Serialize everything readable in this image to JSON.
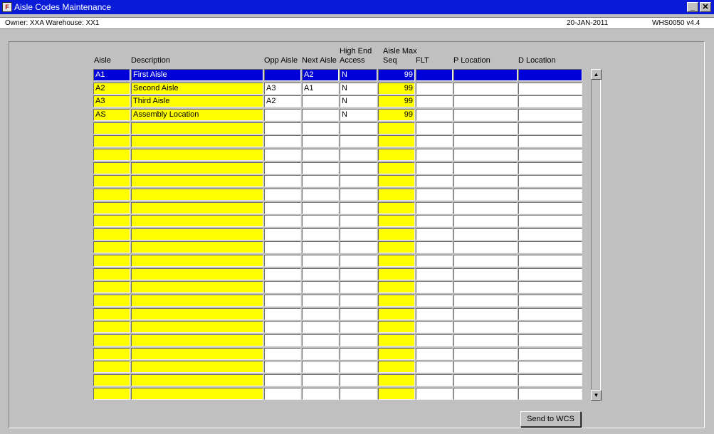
{
  "window": {
    "title": "Aisle Codes Maintenance",
    "minimize_glyph": "_",
    "close_glyph": "✕",
    "app_icon": "oracle-forms-icon"
  },
  "status": {
    "owner": "Owner:  XXA   Warehouse:  XX1",
    "date": "20-JAN-2011",
    "module": "WHS0050  v4.4"
  },
  "columns": {
    "aisle": "Aisle",
    "description": "Description",
    "opp_aisle": "Opp Aisle",
    "next_aisle": "Next Aisle",
    "high_end_1": "High End",
    "high_end_2": "Access",
    "max_seq_1": "Aisle Max",
    "max_seq_2": "Seq",
    "flt": "FLT",
    "p_location": "P Location",
    "d_location": "D Location"
  },
  "rows": [
    {
      "aisle": "A1",
      "description": "First Aisle",
      "opp": "",
      "next": "A2",
      "high": "N",
      "seq": "99",
      "flt": "",
      "p": "",
      "d": ""
    },
    {
      "aisle": "A2",
      "description": "Second Aisle",
      "opp": "A3",
      "next": "A1",
      "high": "N",
      "seq": "99",
      "flt": "",
      "p": "",
      "d": ""
    },
    {
      "aisle": "A3",
      "description": "Third Aisle",
      "opp": "A2",
      "next": "",
      "high": "N",
      "seq": "99",
      "flt": "",
      "p": "",
      "d": ""
    },
    {
      "aisle": "AS",
      "description": "Assembly Location",
      "opp": "",
      "next": "",
      "high": "N",
      "seq": "99",
      "flt": "",
      "p": "",
      "d": ""
    }
  ],
  "selected_row": 0,
  "scroll": {
    "up_glyph": "▲",
    "down_glyph": "▼"
  },
  "buttons": {
    "send_to_wcs": "Send to WCS"
  },
  "colors": {
    "title_bar": "#0a1bd8",
    "selected_row": "#0000d8",
    "required_field": "#ffff00",
    "background": "#c0c0c0"
  }
}
